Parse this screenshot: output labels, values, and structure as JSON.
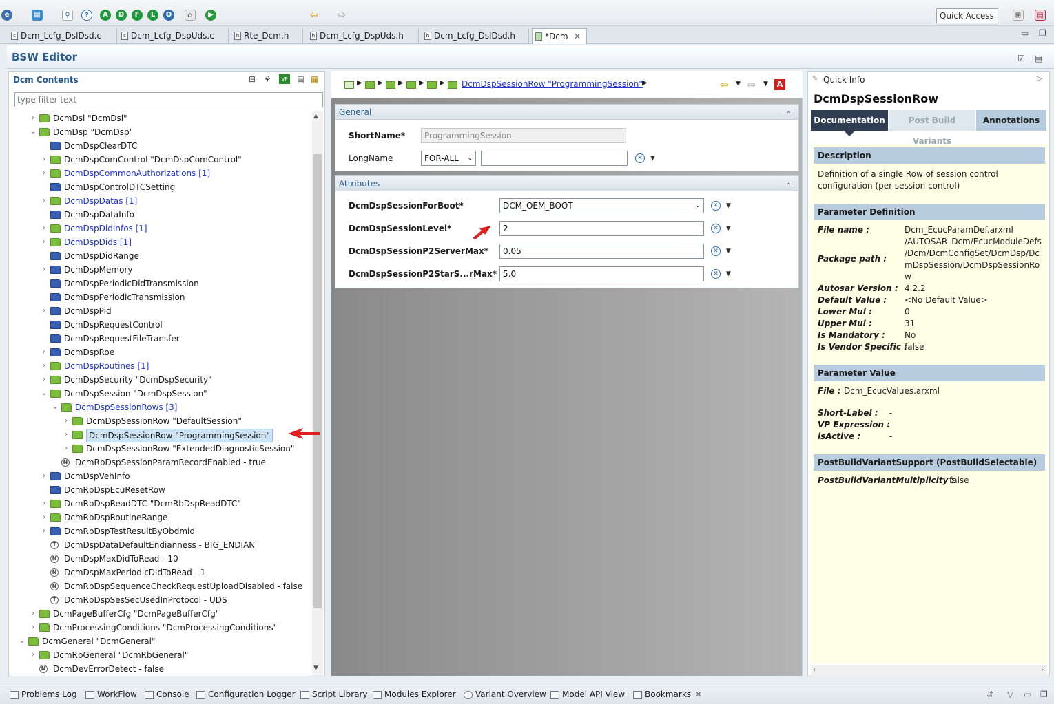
{
  "toolbar": {
    "quick_access": "Quick Access",
    "buttons": [
      "A",
      "D",
      "F",
      "L",
      "O"
    ]
  },
  "editor_tabs": [
    {
      "label": "Dcm_Lcfg_DslDsd.c",
      "icon": "c-file-icon"
    },
    {
      "label": "Dcm_Lcfg_DspUds.c",
      "icon": "c-file-icon"
    },
    {
      "label": "Rte_Dcm.h",
      "icon": "h-file-icon"
    },
    {
      "label": "Dcm_Lcfg_DspUds.h",
      "icon": "h-file-icon"
    },
    {
      "label": "Dcm_Lcfg_DslDsd.h",
      "icon": "h-file-icon"
    },
    {
      "label": "*Dcm",
      "icon": "model-icon"
    }
  ],
  "editor_title": "BSW Editor",
  "left": {
    "title": "Dcm Contents",
    "filter_placeholder": "type filter text",
    "tree": [
      {
        "label": "DcmDsl \"DcmDsl\"",
        "level": 2,
        "icon": "folder-green",
        "toggle": "›"
      },
      {
        "label": "DcmDsp \"DcmDsp\"",
        "level": 2,
        "icon": "folder-green",
        "toggle": "⌄"
      },
      {
        "label": "DcmDspClearDTC",
        "level": 3,
        "icon": "folder-blue",
        "toggle": ""
      },
      {
        "label": "DcmDspComControl \"DcmDspComControl\"",
        "level": 3,
        "icon": "folder-green",
        "toggle": "›"
      },
      {
        "label": "DcmDspCommonAuthorizations [1]",
        "level": 3,
        "icon": "folder-green",
        "toggle": "›",
        "link": true
      },
      {
        "label": "DcmDspControlDTCSetting",
        "level": 3,
        "icon": "folder-blue",
        "toggle": ""
      },
      {
        "label": "DcmDspDatas [1]",
        "level": 3,
        "icon": "folder-green",
        "toggle": "›",
        "link": true
      },
      {
        "label": "DcmDspDataInfo",
        "level": 3,
        "icon": "folder-blue",
        "toggle": ""
      },
      {
        "label": "DcmDspDidInfos [1]",
        "level": 3,
        "icon": "folder-green",
        "toggle": "›",
        "link": true
      },
      {
        "label": "DcmDspDids [1]",
        "level": 3,
        "icon": "folder-green",
        "toggle": "›",
        "link": true
      },
      {
        "label": "DcmDspDidRange",
        "level": 3,
        "icon": "folder-blue",
        "toggle": ""
      },
      {
        "label": "DcmDspMemory",
        "level": 3,
        "icon": "folder-blue",
        "toggle": "›"
      },
      {
        "label": "DcmDspPeriodicDidTransmission",
        "level": 3,
        "icon": "folder-blue",
        "toggle": ""
      },
      {
        "label": "DcmDspPeriodicTransmission",
        "level": 3,
        "icon": "folder-blue",
        "toggle": ""
      },
      {
        "label": "DcmDspPid",
        "level": 3,
        "icon": "folder-blue",
        "toggle": "›"
      },
      {
        "label": "DcmDspRequestControl",
        "level": 3,
        "icon": "folder-blue",
        "toggle": ""
      },
      {
        "label": "DcmDspRequestFileTransfer",
        "level": 3,
        "icon": "folder-blue",
        "toggle": ""
      },
      {
        "label": "DcmDspRoe",
        "level": 3,
        "icon": "folder-blue",
        "toggle": "›"
      },
      {
        "label": "DcmDspRoutines [1]",
        "level": 3,
        "icon": "folder-green",
        "toggle": "›",
        "link": true
      },
      {
        "label": "DcmDspSecurity \"DcmDspSecurity\"",
        "level": 3,
        "icon": "folder-green",
        "toggle": "›"
      },
      {
        "label": "DcmDspSession \"DcmDspSession\"",
        "level": 3,
        "icon": "folder-green",
        "toggle": "⌄"
      },
      {
        "label": "DcmDspSessionRows [3]",
        "level": 4,
        "icon": "folder-green",
        "toggle": "⌄",
        "link": true
      },
      {
        "label": "DcmDspSessionRow \"DefaultSession\"",
        "level": 5,
        "icon": "folder-green",
        "toggle": "›"
      },
      {
        "label": "DcmDspSessionRow \"ProgrammingSession\"",
        "level": 5,
        "icon": "folder-green",
        "toggle": "›",
        "selected": true
      },
      {
        "label": "DcmDspSessionRow \"ExtendedDiagnosticSession\"",
        "level": 5,
        "icon": "folder-green",
        "toggle": "›"
      },
      {
        "label": "DcmRbDspSessionParamRecordEnabled - true",
        "level": 4,
        "icon": "param-n",
        "toggle": ""
      },
      {
        "label": "DcmDspVehInfo",
        "level": 3,
        "icon": "folder-blue",
        "toggle": "›"
      },
      {
        "label": "DcmRbDspEcuResetRow",
        "level": 3,
        "icon": "folder-blue",
        "toggle": ""
      },
      {
        "label": "DcmRbDspReadDTC \"DcmRbDspReadDTC\"",
        "level": 3,
        "icon": "folder-green",
        "toggle": "›"
      },
      {
        "label": "DcmRbDspRoutineRange",
        "level": 3,
        "icon": "folder-green",
        "toggle": "›"
      },
      {
        "label": "DcmRbDspTestResultByObdmid",
        "level": 3,
        "icon": "folder-blue",
        "toggle": "›"
      },
      {
        "label": "DcmDspDataDefaultEndianness - BIG_ENDIAN",
        "level": 3,
        "icon": "param-t",
        "toggle": ""
      },
      {
        "label": "DcmDspMaxDidToRead - 10",
        "level": 3,
        "icon": "param-n",
        "toggle": ""
      },
      {
        "label": "DcmDspMaxPeriodicDidToRead - 1",
        "level": 3,
        "icon": "param-n",
        "toggle": ""
      },
      {
        "label": "DcmRbDspSequenceCheckRequestUploadDisabled - false",
        "level": 3,
        "icon": "param-n",
        "toggle": ""
      },
      {
        "label": "DcmRbDspSesSecUsedInProtocol - UDS",
        "level": 3,
        "icon": "param-t",
        "toggle": ""
      },
      {
        "label": "DcmPageBufferCfg \"DcmPageBufferCfg\"",
        "level": 2,
        "icon": "folder-green",
        "toggle": "›"
      },
      {
        "label": "DcmProcessingConditions \"DcmProcessingConditions\"",
        "level": 2,
        "icon": "folder-green",
        "toggle": "›"
      },
      {
        "label": "DcmGeneral \"DcmGeneral\"",
        "level": 1,
        "icon": "folder-green",
        "toggle": "⌄"
      },
      {
        "label": "DcmRbGeneral \"DcmRbGeneral\"",
        "level": 2,
        "icon": "folder-green",
        "toggle": "›"
      },
      {
        "label": "DcmDevErrorDetect - false",
        "level": 2,
        "icon": "param-n",
        "toggle": ""
      }
    ]
  },
  "middle": {
    "breadcrumb_link": "DcmDspSessionRow \"ProgrammingSession\"",
    "general": {
      "title": "General",
      "shortname_label": "ShortName*",
      "shortname_value": "ProgrammingSession",
      "longname_label": "LongName",
      "longname_lang": "FOR-ALL",
      "longname_value": ""
    },
    "attributes": {
      "title": "Attributes",
      "fields": [
        {
          "label": "DcmDspSessionForBoot*",
          "value": "DCM_OEM_BOOT",
          "combo": true
        },
        {
          "label": "DcmDspSessionLevel*",
          "value": "2",
          "combo": false
        },
        {
          "label": "DcmDspSessionP2ServerMax*",
          "value": "0.05",
          "combo": false
        },
        {
          "label": "DcmDspSessionP2StarS...rMax*",
          "value": "5.0",
          "combo": false
        }
      ]
    }
  },
  "right": {
    "header": "Quick Info",
    "title": "DcmDspSessionRow",
    "tabs": [
      "Documentation",
      "Post Build Variants",
      "Annotations"
    ],
    "description_head": "Description",
    "description_lines": [
      "Definition   of   a   single   Row   of   session   control",
      "configuration (per session control)"
    ],
    "param_def_head": "Parameter Definition",
    "file_name_key": "File name",
    "file_name_val": "Dcm_EcucParamDef.arxml",
    "package_path_key": "Package path",
    "package_path_lines": [
      "/AUTOSAR_Dcm/EcucModuleDefs",
      "/Dcm/DcmConfigSet/DcmDsp/Dc",
      "mDspSession/DcmDspSessionRo",
      "w"
    ],
    "kv": [
      {
        "key": "Autosar Version",
        "val": "4.2.2"
      },
      {
        "key": "Default Value",
        "val": "<No Default Value>"
      },
      {
        "key": "Lower Mul",
        "val": "0"
      },
      {
        "key": "Upper Mul",
        "val": "31"
      },
      {
        "key": "Is Mandatory",
        "val": "No"
      },
      {
        "key": "Is Vendor Specific",
        "val": "false"
      }
    ],
    "param_value_head": "Parameter Value",
    "file_key": "File",
    "file_val": "Dcm_EcucValues.arxml",
    "pv": [
      {
        "key": "Short-Label",
        "val": "-"
      },
      {
        "key": "VP Expression",
        "val": "-"
      },
      {
        "key": "isActive",
        "val": "-"
      }
    ],
    "pbv_head": "PostBuildVariantSupport (PostBuildSelectable)",
    "pbv_key": "PostBuildVariantMultiplicity",
    "pbv_val": "false"
  },
  "bottom_tabs": [
    "Problems Log",
    "WorkFlow",
    "Console",
    "Configuration Logger",
    "Script Library",
    "Modules Explorer",
    "Variant Overview",
    "Model API View",
    "Bookmarks"
  ]
}
